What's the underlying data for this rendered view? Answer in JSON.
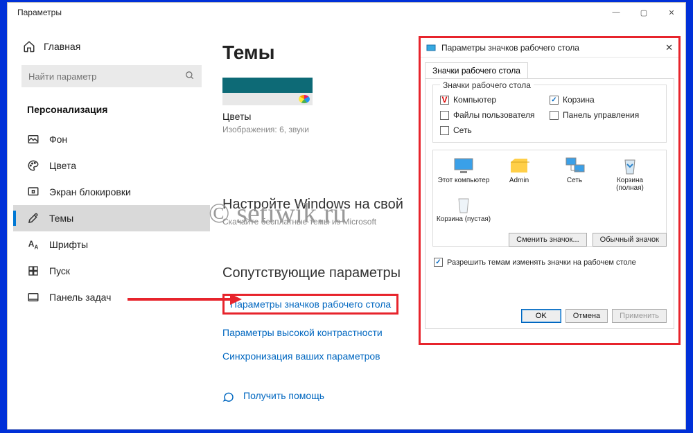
{
  "window": {
    "title": "Параметры",
    "minimize": "—",
    "maximize": "▢",
    "close": "✕"
  },
  "sidebar": {
    "home": "Главная",
    "search_placeholder": "Найти параметр",
    "section": "Персонализация",
    "items": [
      {
        "label": "Фон"
      },
      {
        "label": "Цвета"
      },
      {
        "label": "Экран блокировки"
      },
      {
        "label": "Темы"
      },
      {
        "label": "Шрифты"
      },
      {
        "label": "Пуск"
      },
      {
        "label": "Панель задач"
      }
    ]
  },
  "main": {
    "heading": "Темы",
    "theme_name": "Цветы",
    "theme_sub": "Изображения: 6, звуки",
    "customize": "Настройте Windows на свой",
    "customize_sub": "Скачайте бесплатные темы из Microsoft",
    "related": "Сопутствующие параметры",
    "links": [
      "Параметры значков рабочего стола",
      "Параметры высокой контрастности",
      "Синхронизация ваших параметров"
    ],
    "help": "Получить помощь"
  },
  "dialog": {
    "title": "Параметры значков рабочего стола",
    "tab": "Значки рабочего стола",
    "group": "Значки рабочего стола",
    "checks": {
      "left": [
        "Компьютер",
        "Файлы пользователя",
        "Сеть"
      ],
      "right": [
        "Корзина",
        "Панель управления"
      ]
    },
    "icons": [
      "Этот компьютер",
      "Admin",
      "Сеть",
      "Корзина (полная)",
      "Корзина (пустая)"
    ],
    "change_btn": "Сменить значок...",
    "default_btn": "Обычный значок",
    "allow": "Разрешить темам изменять значки на рабочем столе",
    "ok": "OK",
    "cancel": "Отмена",
    "apply": "Применить"
  },
  "watermark": "© setiwik.ru"
}
